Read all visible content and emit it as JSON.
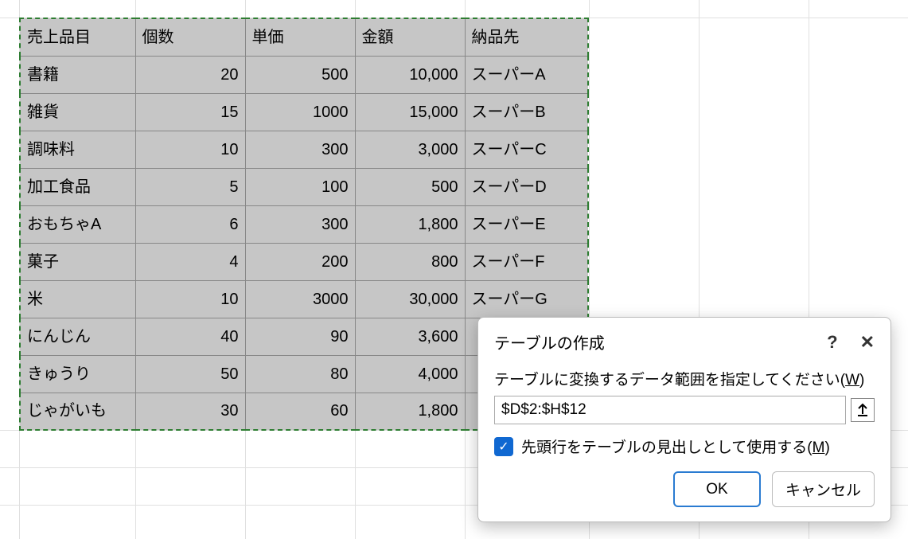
{
  "chart_data": {
    "type": "table",
    "title": "売上品目テーブル",
    "columns": [
      "売上品目",
      "個数",
      "単価",
      "金額",
      "納品先"
    ],
    "rows": [
      [
        "書籍",
        20,
        500,
        10000,
        "スーパーA"
      ],
      [
        "雑貨",
        15,
        1000,
        15000,
        "スーパーB"
      ],
      [
        "調味料",
        10,
        300,
        3000,
        "スーパーC"
      ],
      [
        "加工食品",
        5,
        100,
        500,
        "スーパーD"
      ],
      [
        "おもちゃA",
        6,
        300,
        1800,
        "スーパーE"
      ],
      [
        "菓子",
        4,
        200,
        800,
        "スーパーF"
      ],
      [
        "米",
        10,
        3000,
        30000,
        "スーパーG"
      ],
      [
        "にんじん",
        40,
        90,
        3600,
        ""
      ],
      [
        "きゅうり",
        50,
        80,
        4000,
        ""
      ],
      [
        "じゃがいも",
        30,
        60,
        1800,
        ""
      ]
    ]
  },
  "table": {
    "headers": [
      "売上品目",
      "個数",
      "単価",
      "金額",
      "納品先"
    ],
    "rows": [
      {
        "item": "書籍",
        "qty": "20",
        "unit": "500",
        "amount": "10,000",
        "dest": "スーパーA"
      },
      {
        "item": "雑貨",
        "qty": "15",
        "unit": "1000",
        "amount": "15,000",
        "dest": "スーパーB"
      },
      {
        "item": "調味料",
        "qty": "10",
        "unit": "300",
        "amount": "3,000",
        "dest": "スーパーC"
      },
      {
        "item": "加工食品",
        "qty": "5",
        "unit": "100",
        "amount": "500",
        "dest": "スーパーD"
      },
      {
        "item": "おもちゃA",
        "qty": "6",
        "unit": "300",
        "amount": "1,800",
        "dest": "スーパーE"
      },
      {
        "item": "菓子",
        "qty": "4",
        "unit": "200",
        "amount": "800",
        "dest": "スーパーF"
      },
      {
        "item": "米",
        "qty": "10",
        "unit": "3000",
        "amount": "30,000",
        "dest": "スーパーG"
      },
      {
        "item": "にんじん",
        "qty": "40",
        "unit": "90",
        "amount": "3,600",
        "dest": ""
      },
      {
        "item": "きゅうり",
        "qty": "50",
        "unit": "80",
        "amount": "4,000",
        "dest": ""
      },
      {
        "item": "じゃがいも",
        "qty": "30",
        "unit": "60",
        "amount": "1,800",
        "dest": ""
      }
    ]
  },
  "dialog": {
    "title": "テーブルの作成",
    "help": "?",
    "close": "✕",
    "label_prefix": "テーブルに変換するデータ範囲を指定してください(",
    "label_hotkey": "W",
    "label_suffix": ")",
    "range": "$D$2:$H$12",
    "collapse_icon": "↥",
    "checkbox_prefix": "先頭行をテーブルの見出しとして使用する(",
    "checkbox_hotkey": "M",
    "checkbox_suffix": ")",
    "checkmark": "✓",
    "ok": "OK",
    "cancel": "キャンセル"
  }
}
